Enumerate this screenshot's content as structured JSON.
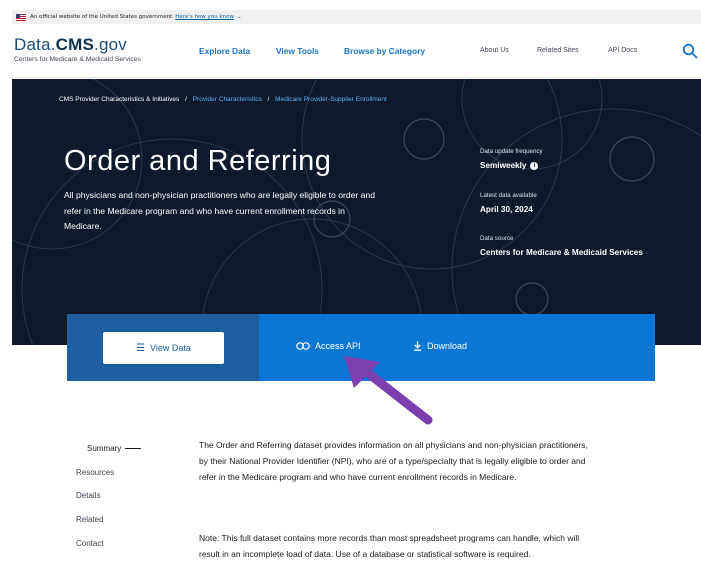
{
  "gov_banner": {
    "text": "An official website of the United States government",
    "link": "Here's how you know",
    "chevron": "⌄"
  },
  "header": {
    "logo_prefix": "Data.",
    "logo_bold": "CMS",
    "logo_suffix": ".gov",
    "logo_subtitle": "Centers for Medicare & Medicaid Services",
    "nav_primary": [
      "Explore Data",
      "View Tools",
      "Browse by Category"
    ],
    "nav_secondary": [
      "About Us",
      "Related Sites",
      "API Docs"
    ]
  },
  "breadcrumb": {
    "items": [
      "CMS Provider Characteristics & Initiatives",
      "Provider Characteristics",
      "Medicare Provider-Supplier Enrollment"
    ],
    "separator": "/"
  },
  "hero": {
    "title": "Order and Referring",
    "description": "All physicians and non-physician practitioners who are legally eligible to order and refer in the Medicare program and who have current enrollment records in Medicare.",
    "meta": [
      {
        "label": "Data update frequency",
        "value": "Semiweekly",
        "info": "i"
      },
      {
        "label": "Latest data available",
        "value": "April 30, 2024"
      },
      {
        "label": "Data source",
        "value": "Centers for Medicare & Medicaid Services"
      }
    ]
  },
  "actions": {
    "view_data": "View Data",
    "access_api": "Access API",
    "download": "Download"
  },
  "side_nav": [
    "Summary",
    "Resources",
    "Details",
    "Related",
    "Contact"
  ],
  "content": {
    "summary": "The Order and Referring dataset provides information on all physicians and non-physician practitioners, by their National Provider Identifier (NPI), who are of a type/specialty that is legally eligible to order and refer in the Medicare program and who have current enrollment records in Medicare.",
    "note": "Note: This full dataset contains more records than most spreadsheet programs can handle, which will result in an incomplete load of data. Use of a database or statistical software is required."
  },
  "colors": {
    "hero_bg": "#0e1a2b",
    "action_dark": "#1f5ea0",
    "action_bright": "#0b76d4",
    "link": "#1a73c5",
    "arrow": "#7b3fb0"
  }
}
